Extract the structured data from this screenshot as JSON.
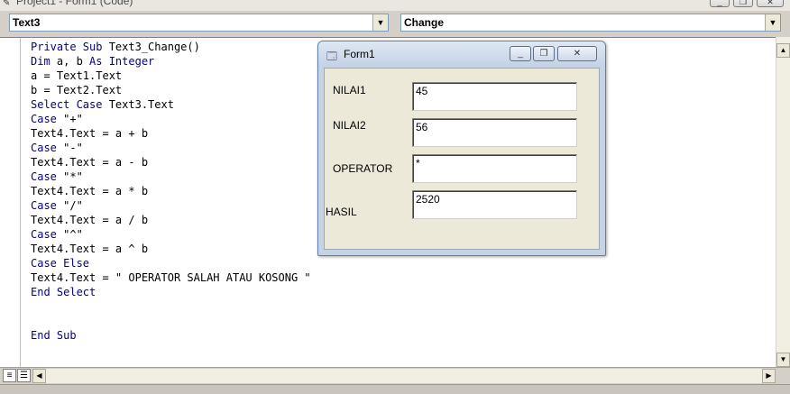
{
  "window": {
    "title": "Project1 - Form1 (Code)",
    "minimize_glyph": "_",
    "restore_glyph": "❐",
    "close_glyph": "✕"
  },
  "object_combo": {
    "value": "Text3"
  },
  "procedure_combo": {
    "value": "Change"
  },
  "code_lines": [
    {
      "kw": "Private Sub ",
      "rest": "Text3_Change()"
    },
    {
      "kw": "Dim ",
      "rest": "a, b ",
      "kw2": "As Integer"
    },
    {
      "kw": "",
      "rest": "a = Text1.Text"
    },
    {
      "kw": "",
      "rest": "b = Text2.Text"
    },
    {
      "kw": "Select Case ",
      "rest": "Text3.Text"
    },
    {
      "kw": "Case ",
      "rest": "\"+\""
    },
    {
      "kw": "",
      "rest": "Text4.Text = a + b"
    },
    {
      "kw": "Case ",
      "rest": "\"-\""
    },
    {
      "kw": "",
      "rest": "Text4.Text = a - b"
    },
    {
      "kw": "Case ",
      "rest": "\"*\""
    },
    {
      "kw": "",
      "rest": "Text4.Text = a * b"
    },
    {
      "kw": "Case ",
      "rest": "\"/\""
    },
    {
      "kw": "",
      "rest": "Text4.Text = a / b"
    },
    {
      "kw": "Case ",
      "rest": "\"^\""
    },
    {
      "kw": "",
      "rest": "Text4.Text = a ^ b"
    },
    {
      "kw": "Case Else",
      "rest": ""
    },
    {
      "kw": "",
      "rest": "Text4.Text = \" OPERATOR SALAH ATAU KOSONG \""
    },
    {
      "kw": "End Select",
      "rest": ""
    },
    {
      "kw": "",
      "rest": ""
    },
    {
      "kw": "",
      "rest": ""
    },
    {
      "kw": "End Sub",
      "rest": ""
    }
  ],
  "form1": {
    "title": "Form1",
    "fields": [
      {
        "label": "NILAI1",
        "value": "45"
      },
      {
        "label": "NILAI2",
        "value": "56"
      },
      {
        "label": "OPERATOR",
        "value": "*"
      },
      {
        "label": "HASIL",
        "value": "2520"
      }
    ]
  },
  "colors": {
    "keyword": "#00008b",
    "code_text": "#000000",
    "editor_bg": "#ffffff",
    "form_bg": "#ece9d8"
  }
}
